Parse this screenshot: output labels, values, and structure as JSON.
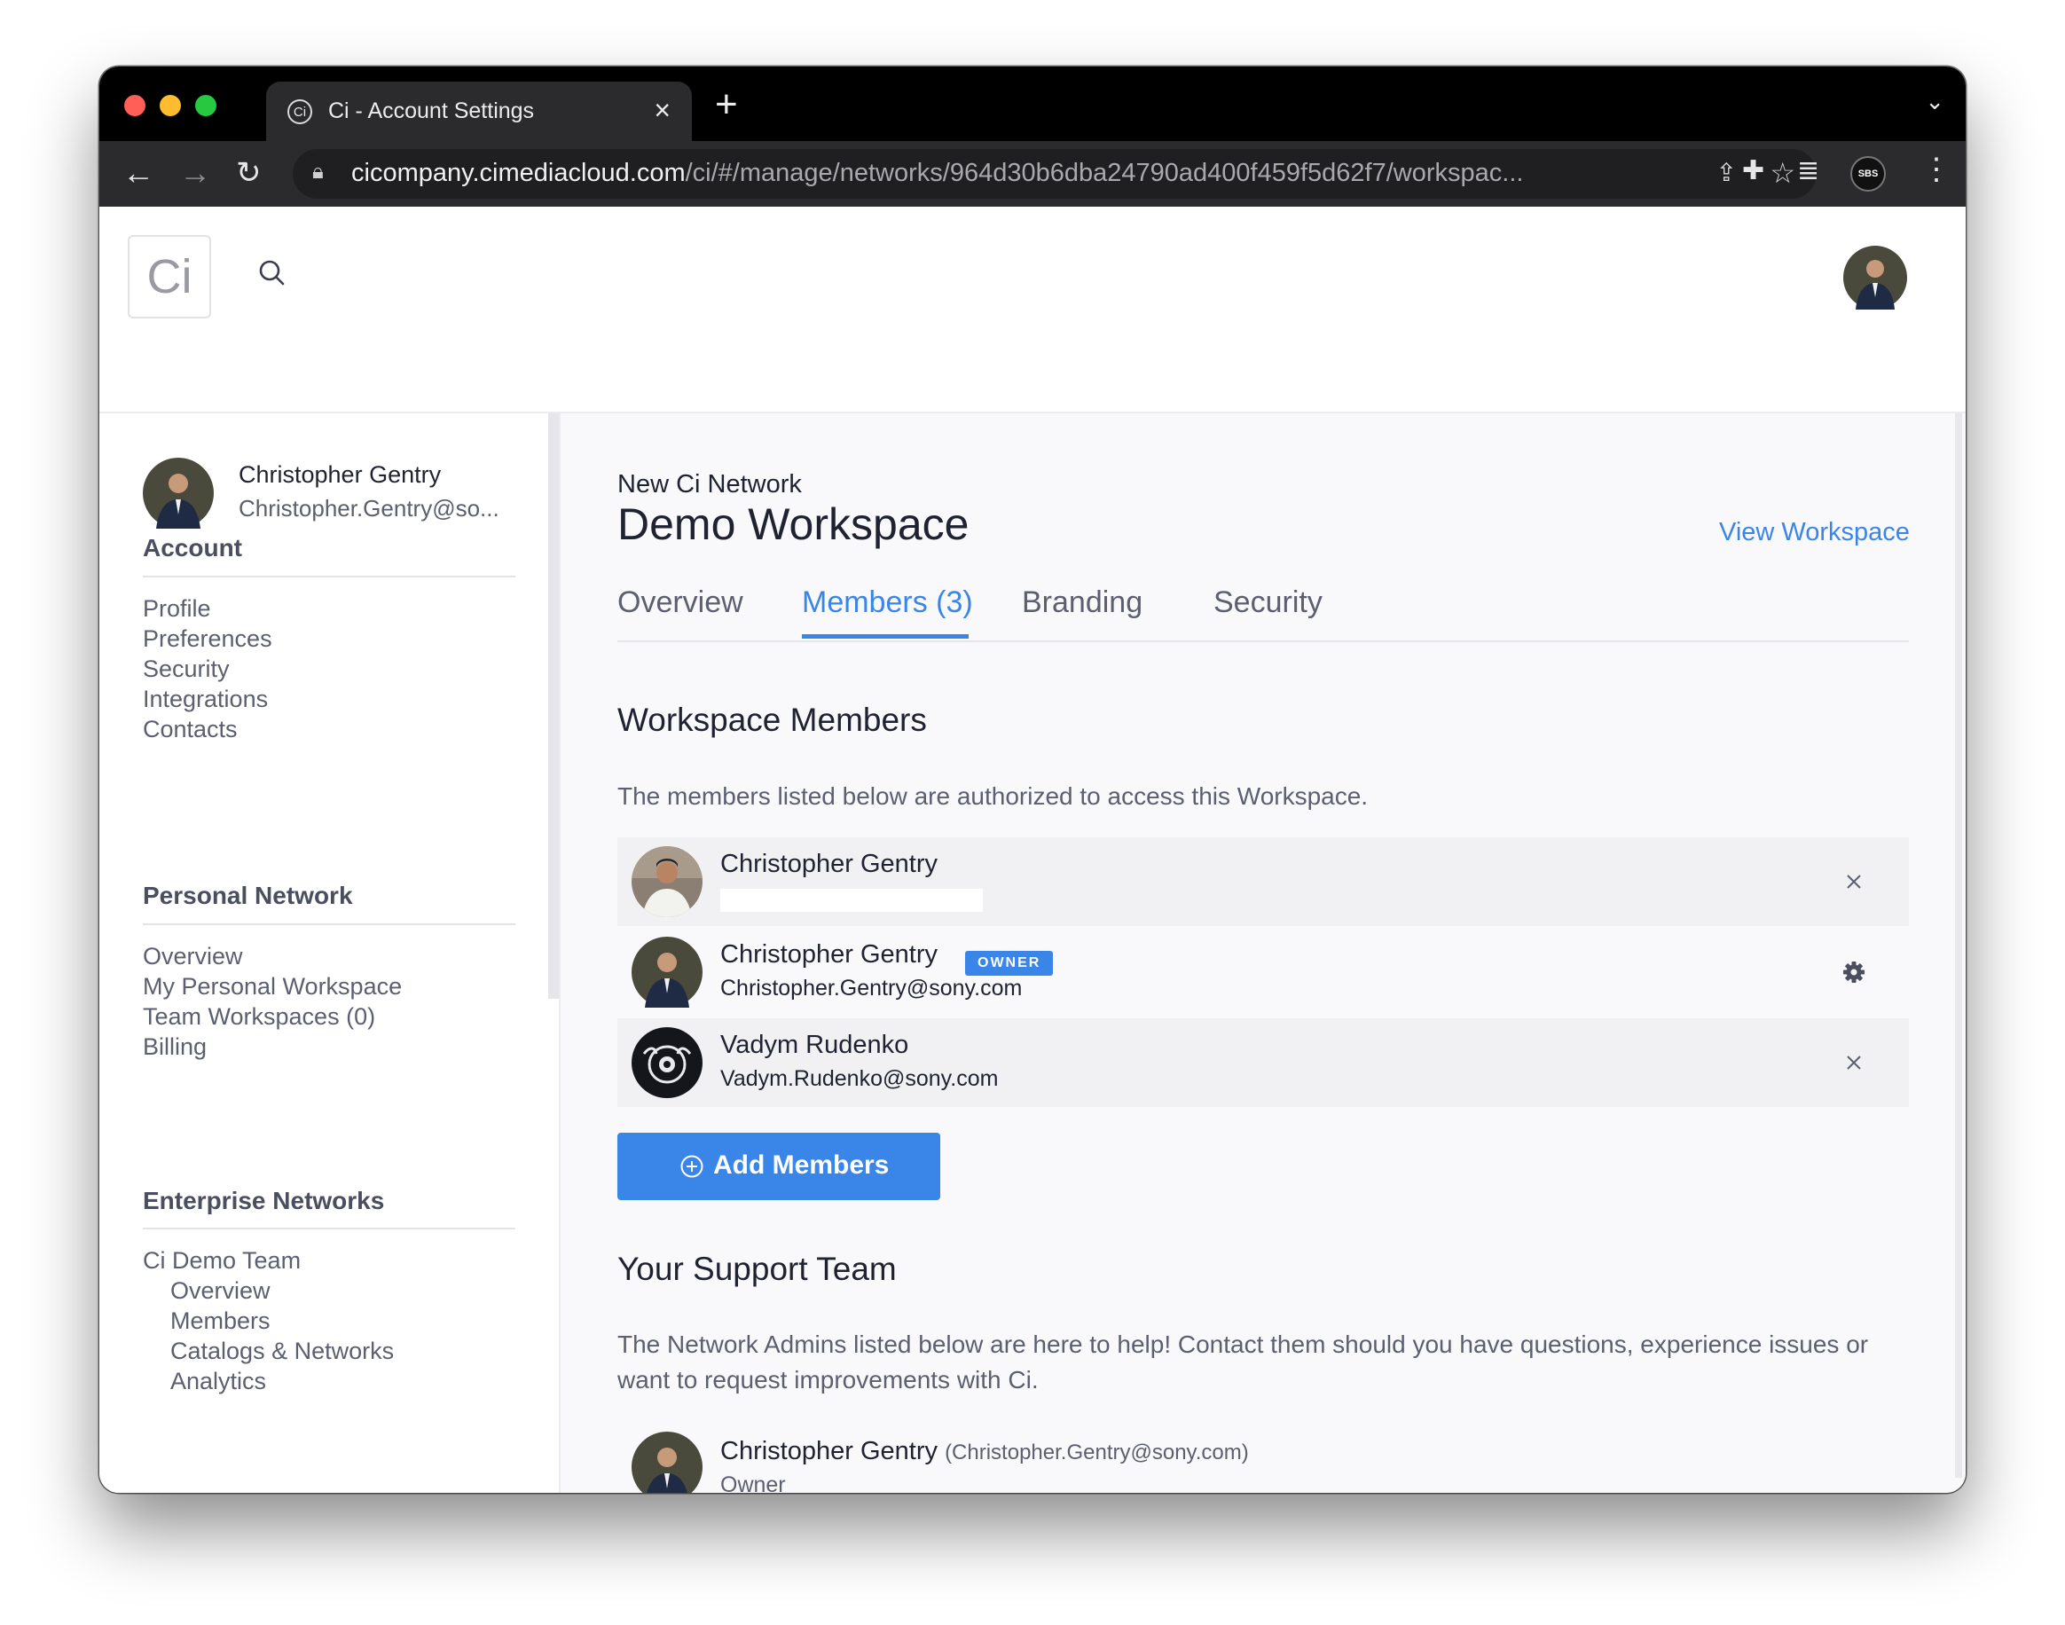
{
  "browser": {
    "tab_title": "Ci - Account Settings",
    "tab_favicon": "Ci",
    "url_host": "cicompany.cimediacloud.com",
    "url_path": "/ci/#/manage/networks/964d30b6dba24790ad400f459f5d62f7/workspac...",
    "profile_badge": "SBS",
    "colors": {
      "close": "#ff5f57",
      "minimize": "#febc2e",
      "zoom": "#28c840"
    }
  },
  "app": {
    "logo_text": "Ci"
  },
  "sidebar": {
    "user": {
      "name": "Christopher Gentry",
      "email": "Christopher.Gentry@so..."
    },
    "sections": [
      {
        "heading": "Account",
        "items": [
          "Profile",
          "Preferences",
          "Security",
          "Integrations",
          "Contacts"
        ]
      },
      {
        "heading": "Personal Network",
        "items": [
          "Overview",
          "My Personal Workspace",
          "Team Workspaces (0)",
          "Billing"
        ]
      },
      {
        "heading": "Enterprise Networks",
        "group": "Ci Demo Team",
        "items": [
          "Overview",
          "Members",
          "Catalogs & Networks",
          "Analytics"
        ]
      }
    ]
  },
  "main": {
    "network_name": "New Ci Network",
    "workspace_title": "Demo Workspace",
    "view_workspace": "View Workspace",
    "tabs": [
      "Overview",
      "Members (3)",
      "Branding",
      "Security"
    ],
    "active_tab": "Members (3)",
    "members_section": {
      "title": "Workspace Members",
      "description": "The members listed below are authorized to access this Workspace.",
      "members": [
        {
          "name": "Christopher Gentry",
          "email": "",
          "badge": "",
          "action_icon": "close-icon"
        },
        {
          "name": "Christopher Gentry",
          "email": "Christopher.Gentry@sony.com",
          "badge": "OWNER",
          "action_icon": "gear-icon"
        },
        {
          "name": "Vadym Rudenko",
          "email": "Vadym.Rudenko@sony.com",
          "badge": "",
          "action_icon": "close-icon"
        }
      ],
      "add_button": "Add Members"
    },
    "support_section": {
      "title": "Your Support Team",
      "description": "The Network Admins listed below are here to help! Contact them should you have questions, experience issues or want to request improvements with Ci.",
      "admin": {
        "name": "Christopher Gentry",
        "email": "(Christopher.Gentry@sony.com)",
        "role": "Owner"
      }
    },
    "accent_color": "#3a86e8"
  }
}
